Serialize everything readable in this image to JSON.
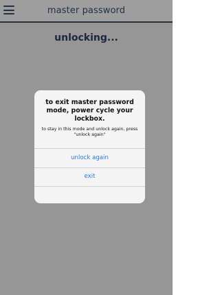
{
  "header": {
    "menu_icon": "hamburger-menu-icon",
    "title": "master password"
  },
  "main": {
    "status": "unlocking..."
  },
  "dialog": {
    "title": "to exit master password mode, power cycle your lockbox.",
    "message": "to stay in this mode and unlock again, press \"unlock again\"",
    "unlock_again_label": "unlock again",
    "exit_label": "exit"
  },
  "colors": {
    "header_text": "#374f6e",
    "header_rule": "#3b4f6a",
    "status_text": "#2d4263",
    "dialog_button": "#2b7bd6"
  }
}
